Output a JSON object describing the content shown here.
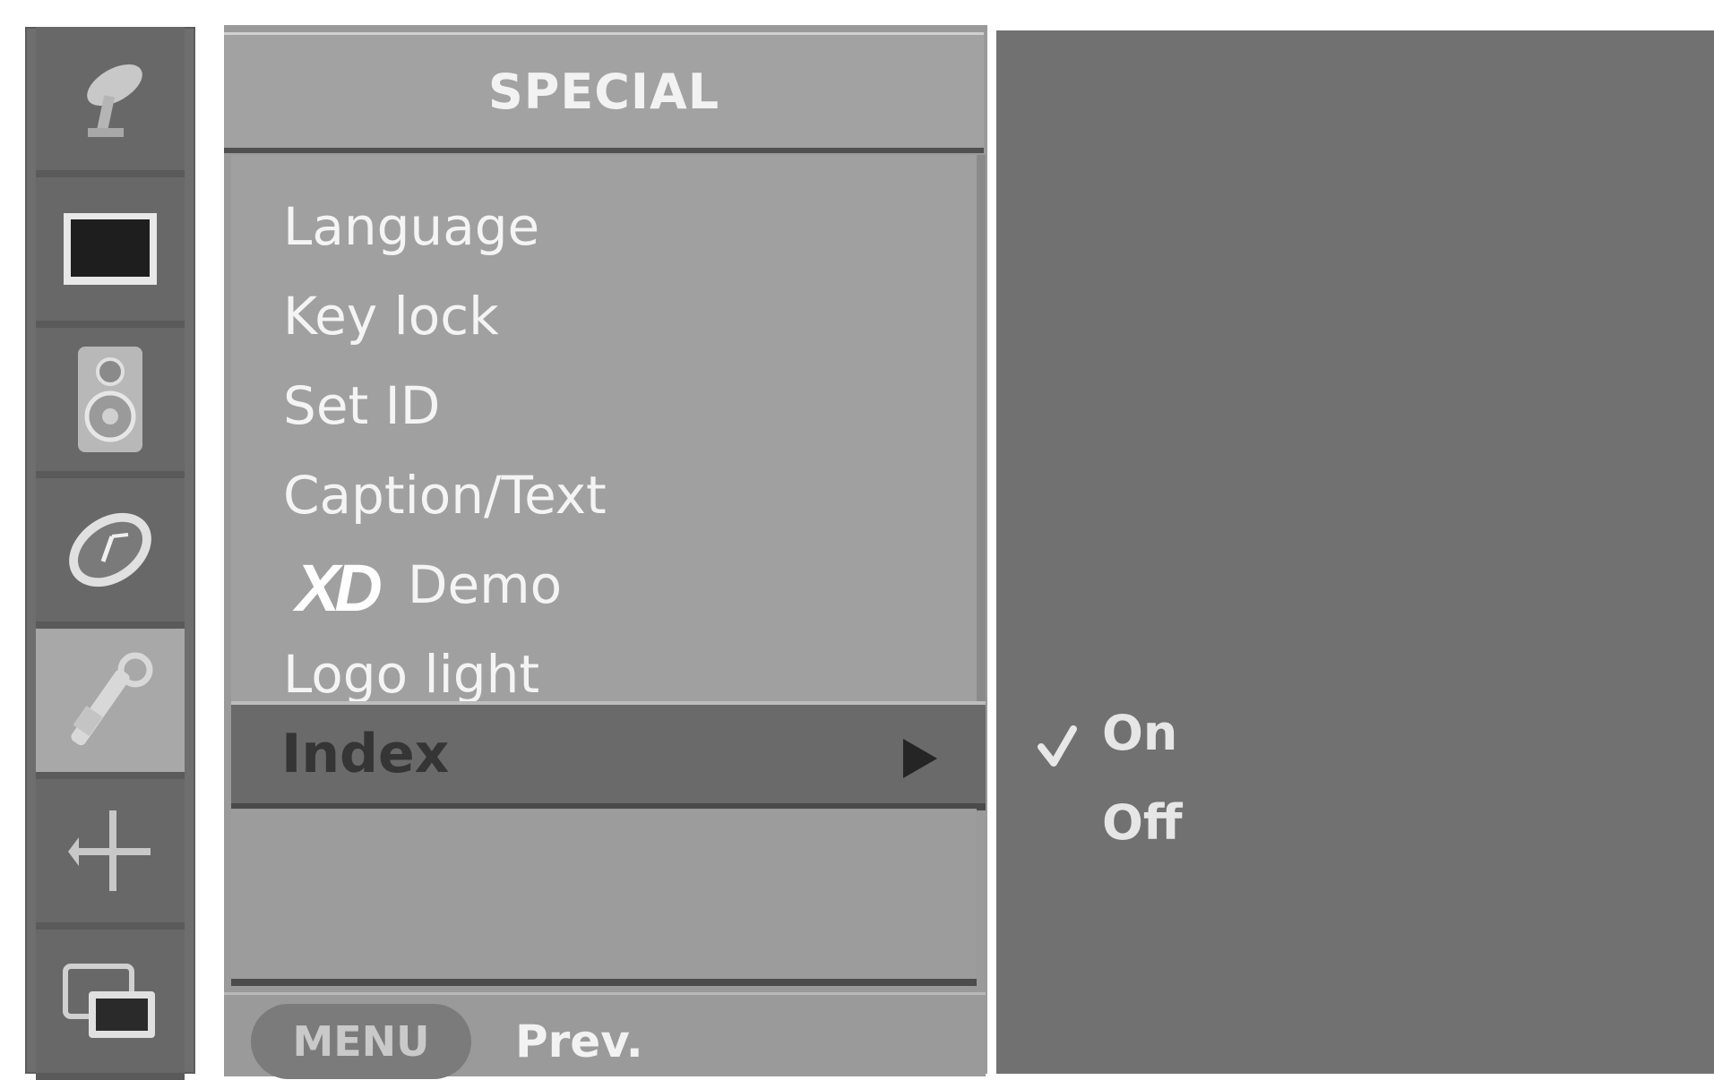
{
  "menu": {
    "title": "SPECIAL",
    "items": [
      {
        "label": "Language"
      },
      {
        "label": "Key lock"
      },
      {
        "label": "Set ID"
      },
      {
        "label": "Caption/Text"
      },
      {
        "logo": "XD",
        "label": "Demo"
      },
      {
        "label": "Logo light"
      }
    ],
    "selected_item": {
      "label": "Index",
      "icon": "arrow-right-icon"
    }
  },
  "submenu": {
    "options": [
      {
        "label": "On",
        "checked": true
      },
      {
        "label": "Off",
        "checked": false
      }
    ]
  },
  "footer": {
    "button_label": "MENU",
    "button_action": "Prev."
  },
  "rail": {
    "icons": [
      "satellite-dish-icon",
      "picture-icon",
      "speaker-icon",
      "clock-icon",
      "tools-icon",
      "position-icon",
      "screen-icon"
    ],
    "selected_icon": "tools-icon"
  }
}
